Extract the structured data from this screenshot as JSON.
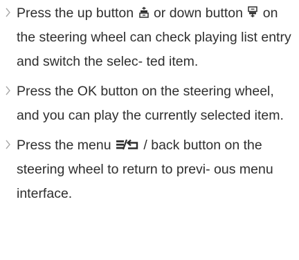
{
  "items": [
    {
      "part1": "Press the up button ",
      "icon1": "phone-answer-icon",
      "part2": " or down button ",
      "icon2": "phone-hangup-icon",
      "part3": " on the steering wheel can check playing list entry and switch the selec- ted item."
    },
    {
      "text": "Press the OK button on the steering wheel, and you can play the currently selected item."
    },
    {
      "part1": "Press the menu ",
      "icon1": "menu-back-icon",
      "part2": " / back button on the steering wheel to return to previ- ous menu interface."
    }
  ],
  "bullet_icon": "chevron-right-icon",
  "colors": {
    "text": "#2e2e2e",
    "bullet": "#a8a8a8",
    "background": "#ffffff"
  }
}
